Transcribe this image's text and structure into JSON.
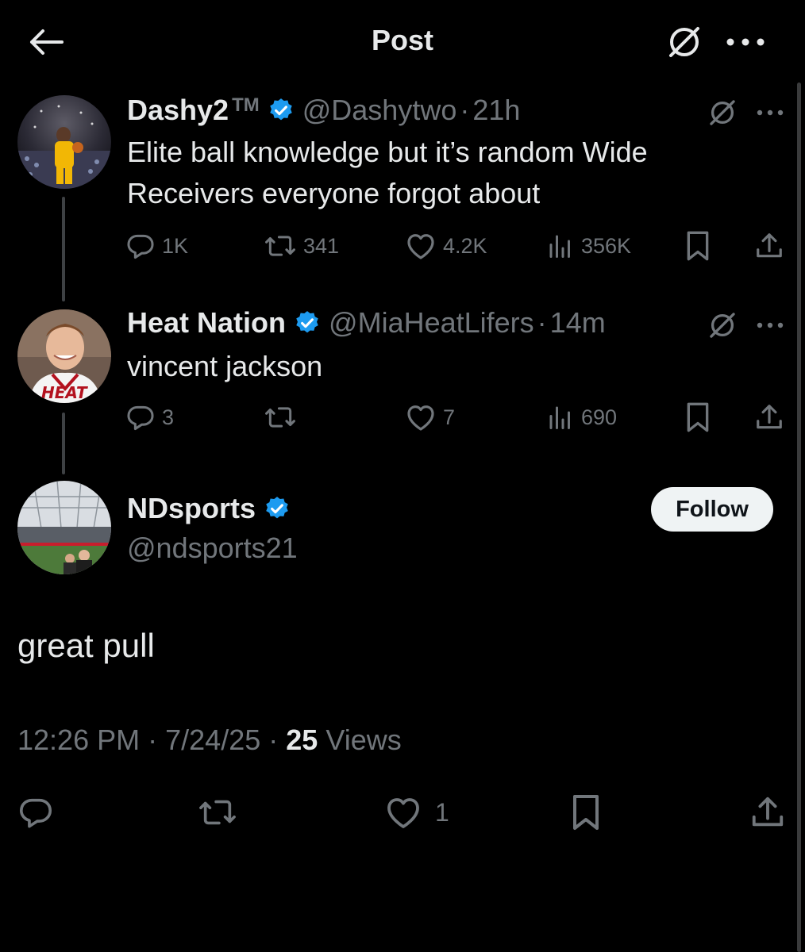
{
  "header": {
    "title": "Post",
    "back_icon": "arrow-left-icon",
    "grok_icon": "grok-slash-circle-icon",
    "more_icon": "more-horizontal-icon"
  },
  "colors": {
    "background": "#000000",
    "text_primary": "#e7e9ea",
    "text_secondary": "#71767b",
    "verified_blue": "#1d9bf0",
    "follow_bg": "#eff3f4",
    "thread_line": "#3e4144"
  },
  "thread": [
    {
      "display_name": "Dashy2",
      "name_suffix": "TM",
      "verified": true,
      "handle": "@Dashytwo",
      "separator": "·",
      "time": "21h",
      "text_lines": [
        "Elite ball knowledge but it’s random Wide",
        "Receivers everyone forgot about"
      ],
      "stats": {
        "replies": "1K",
        "reposts": "341",
        "likes": "4.2K",
        "views": "356K"
      }
    },
    {
      "display_name": "Heat Nation",
      "verified": true,
      "handle": "@MiaHeatLifers",
      "separator": "·",
      "time": "14m",
      "text_lines": [
        "vincent jackson"
      ],
      "stats": {
        "replies": "3",
        "reposts": "",
        "likes": "7",
        "views": "690"
      }
    }
  ],
  "main_post": {
    "display_name": "NDsports",
    "verified": true,
    "handle": "@ndsports21",
    "follow_label": "Follow",
    "text": "great pull",
    "time": "12:26 PM",
    "date": "7/24/25",
    "separator": "·",
    "views_count": "25",
    "views_label": "Views",
    "stats": {
      "likes": "1"
    }
  }
}
